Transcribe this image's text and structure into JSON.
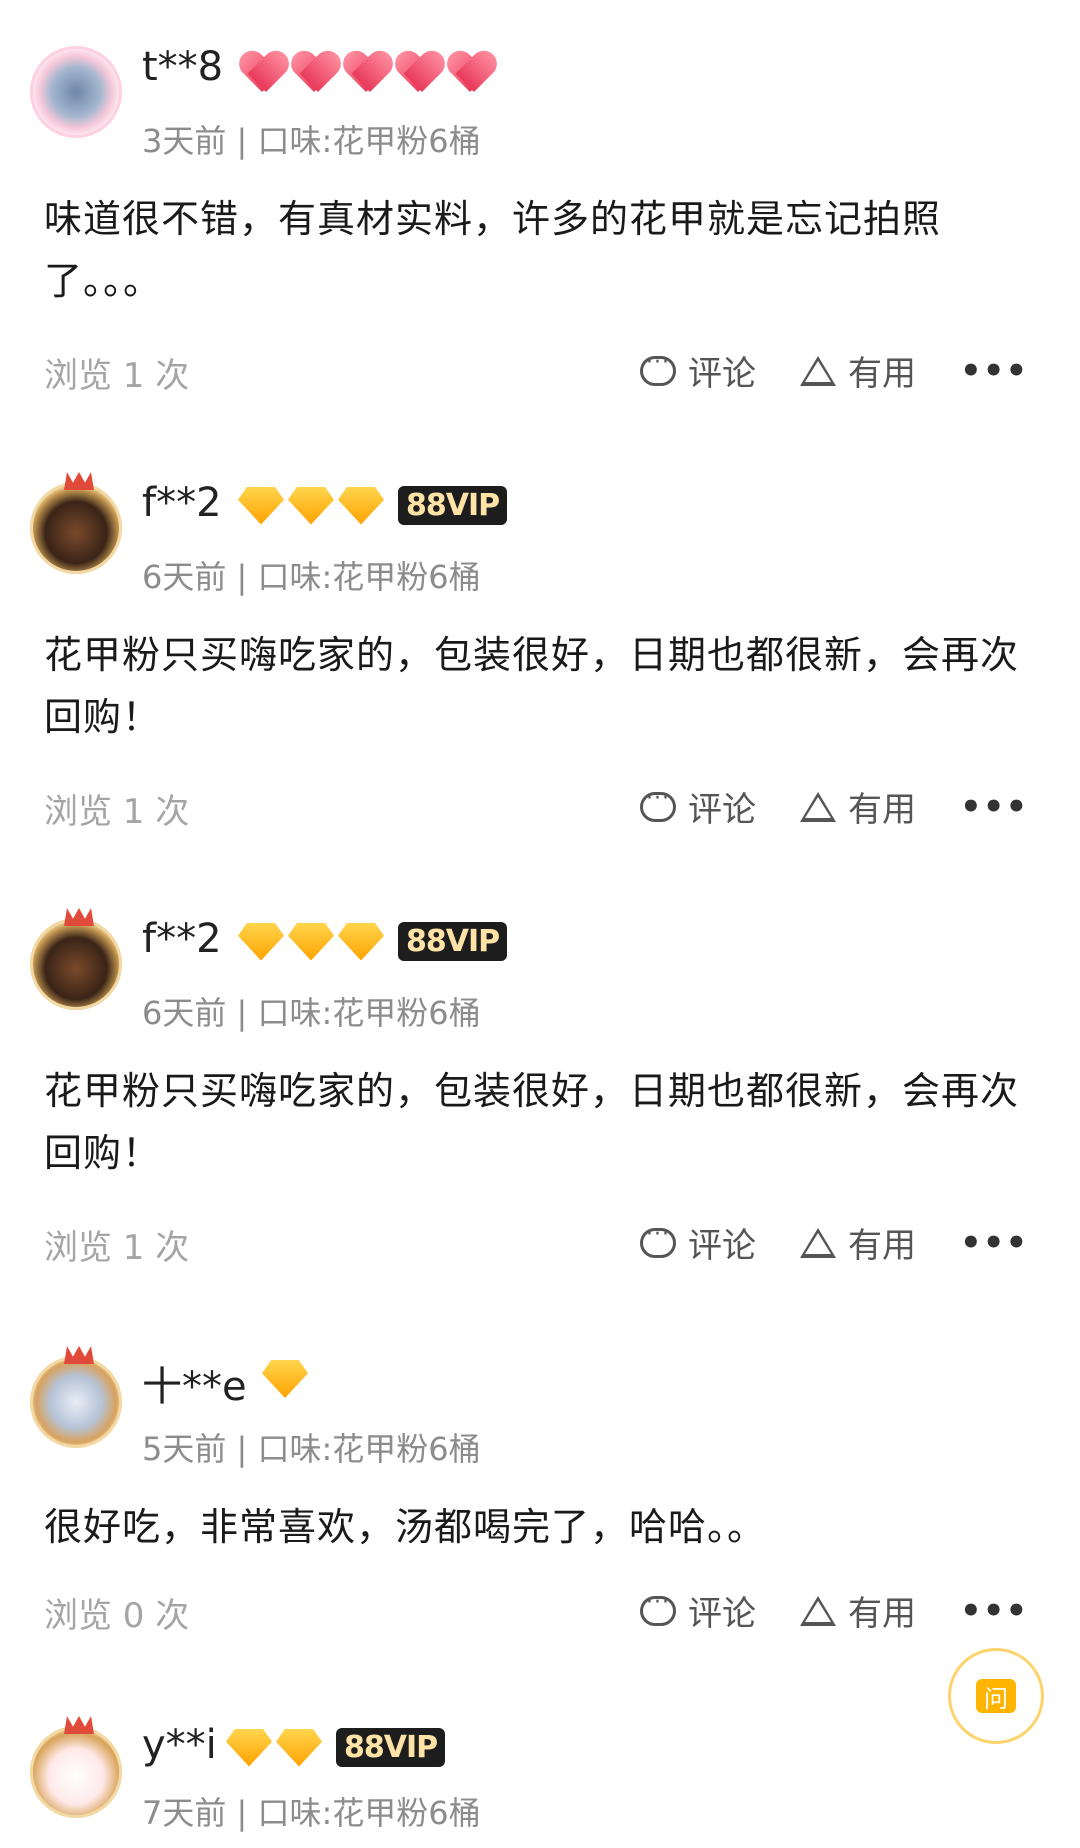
{
  "reviews": [
    {
      "user": "t**8",
      "badge_type": "heart",
      "badge_count": 5,
      "vip": "",
      "meta": "3天前 | 口味:花甲粉6桶",
      "text": "味道很不错，有真材实料，许多的花甲就是忘记拍照了。。。",
      "views": "浏览 1 次"
    },
    {
      "user": "f**2",
      "badge_type": "diamond",
      "badge_count": 3,
      "vip": "88VIP",
      "meta": "6天前 | 口味:花甲粉6桶",
      "text": "花甲粉只买嗨吃家的，包装很好，日期也都很新，会再次回购！",
      "views": "浏览 1 次"
    },
    {
      "user": "f**2",
      "badge_type": "diamond",
      "badge_count": 3,
      "vip": "88VIP",
      "meta": "6天前 | 口味:花甲粉6桶",
      "text": "花甲粉只买嗨吃家的，包装很好，日期也都很新，会再次回购！",
      "views": "浏览 1 次"
    },
    {
      "user": "十**e",
      "badge_type": "diamond",
      "badge_count": 1,
      "vip": "",
      "meta": "5天前 | 口味:花甲粉6桶",
      "text": "很好吃，非常喜欢，汤都喝完了，哈哈。。",
      "views": "浏览 0 次"
    },
    {
      "user": "y**i",
      "badge_type": "diamond",
      "badge_count": 2,
      "vip": "88VIP",
      "meta": "7天前 | 口味:花甲粉6桶",
      "text": "",
      "views": ""
    }
  ],
  "actions": {
    "comment": "评论",
    "useful": "有用",
    "more": "•••"
  },
  "ask_button": "问"
}
